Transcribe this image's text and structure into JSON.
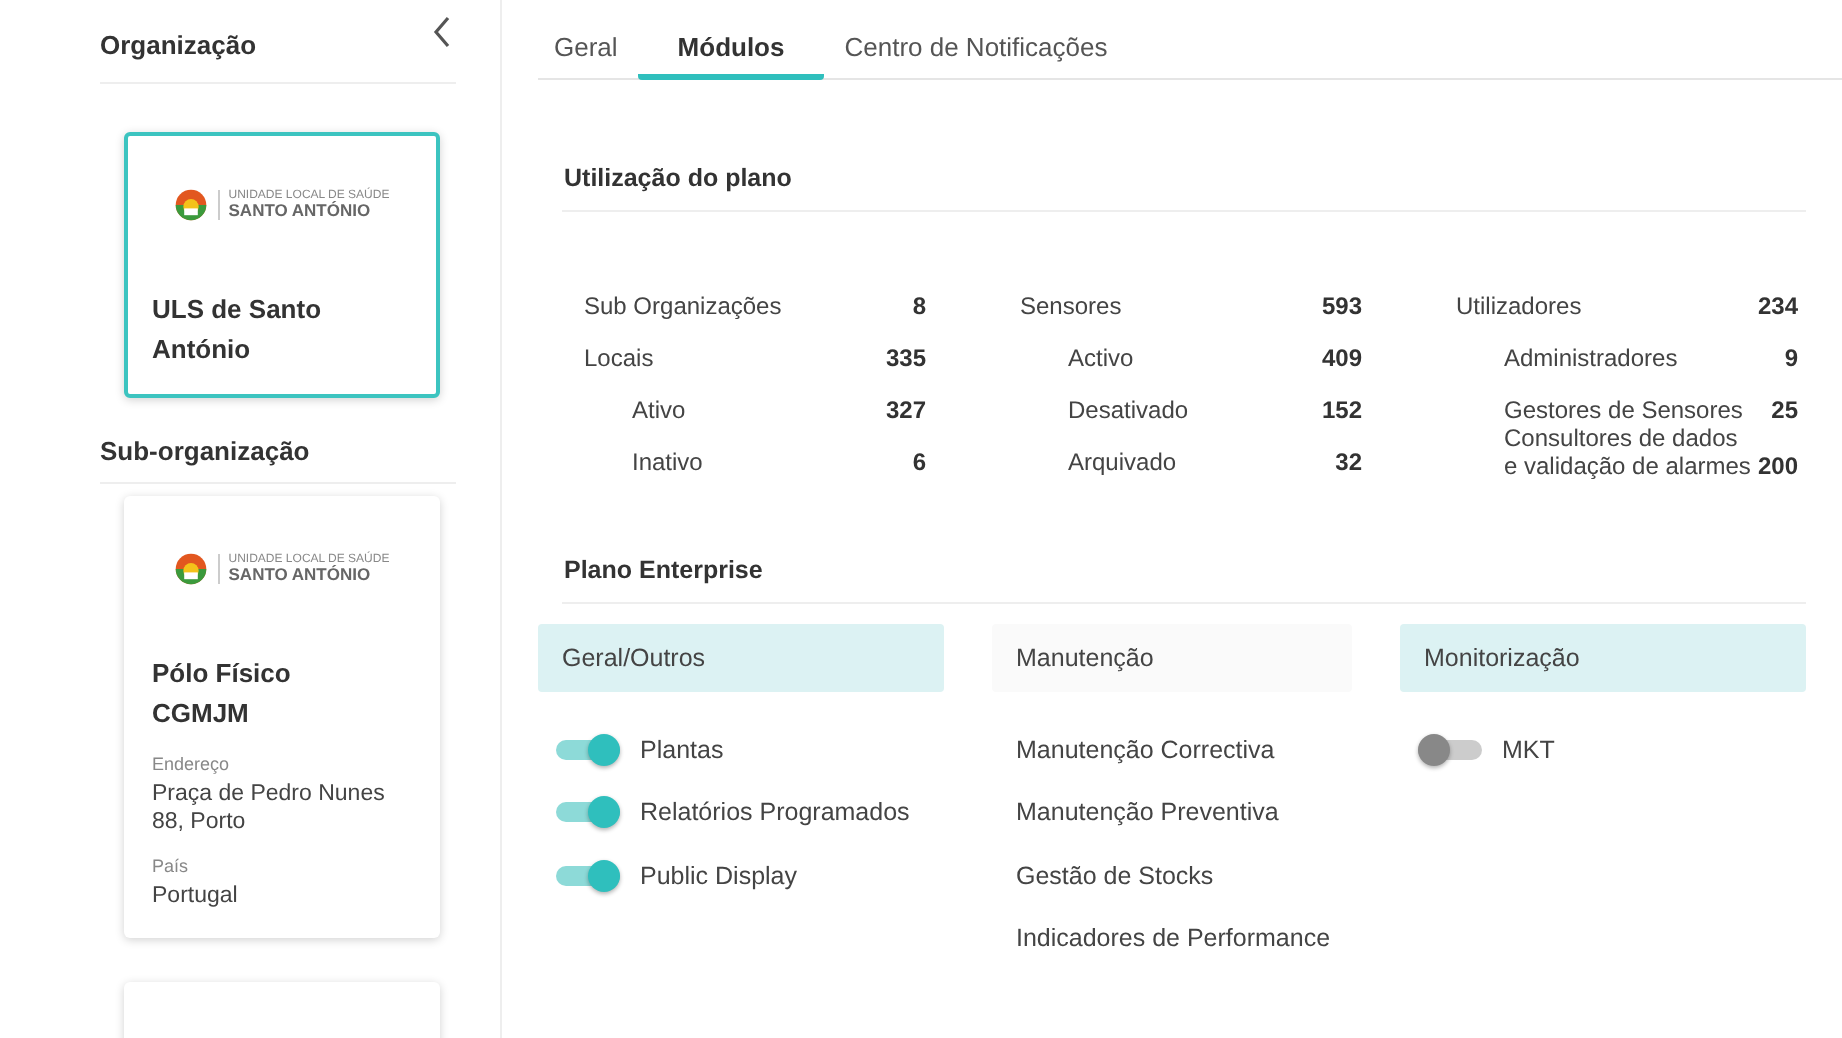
{
  "sidebar": {
    "title": "Organização",
    "organization": {
      "logo": [
        "UNIDADE LOCAL DE SAÚDE",
        "SANTO ANTÓNIO"
      ],
      "name": "ULS de Santo António",
      "selected": true
    },
    "sub_title": "Sub-organização",
    "sub_organizations": [
      {
        "logo": [
          "UNIDADE LOCAL DE SAÚDE",
          "SANTO ANTÓNIO"
        ],
        "name": "Pólo Físico CGMJM",
        "fields": [
          {
            "label": "Endereço",
            "value": "Praça de Pedro Nunes 88, Porto"
          },
          {
            "label": "País",
            "value": "Portugal"
          }
        ],
        "selected": false
      },
      {
        "selected": false
      }
    ]
  },
  "tabs": [
    {
      "label": "Geral",
      "selected": false
    },
    {
      "label": "Módulos",
      "selected": true
    },
    {
      "label": "Centro de Notificações",
      "selected": false
    }
  ],
  "usage": {
    "title": "Utilização do plano",
    "columns": [
      [
        {
          "label": "Sub Organizações",
          "value": "8"
        },
        {
          "label": "Locais",
          "value": "335",
          "children": [
            {
              "label": "Ativo",
              "value": "327"
            },
            {
              "label": "Inativo",
              "value": "6"
            }
          ]
        }
      ],
      [
        {
          "label": "Sensores",
          "value": "593",
          "children": [
            {
              "label": "Activo",
              "value": "409"
            },
            {
              "label": "Desativado",
              "value": "152"
            },
            {
              "label": "Arquivado",
              "value": "32"
            }
          ]
        }
      ],
      [
        {
          "label": "Utilizadores",
          "value": "234",
          "children": [
            {
              "label": "Administradores",
              "value": "9"
            },
            {
              "label": "Gestores de Sensores",
              "value": "25"
            },
            {
              "label": "Consultores de dados e validação de alarmes",
              "value": "200"
            }
          ]
        }
      ]
    ]
  },
  "plan": {
    "title": "Plano Enterprise",
    "groups": [
      {
        "title": "Geral/Outros",
        "active": true,
        "items": [
          {
            "kind": "toggle",
            "label": "Plantas",
            "on": true
          },
          {
            "kind": "toggle",
            "label": "Relatórios Programados",
            "on": true
          },
          {
            "kind": "toggle",
            "label": "Public Display",
            "on": true
          }
        ]
      },
      {
        "title": "Manutenção",
        "active": false,
        "items": [
          {
            "kind": "plain",
            "label": "Manutenção Correctiva"
          },
          {
            "kind": "plain",
            "label": "Manutenção Preventiva"
          },
          {
            "kind": "plain",
            "label": "Gestão de Stocks"
          },
          {
            "kind": "plain",
            "label": "Indicadores de Performance"
          }
        ]
      },
      {
        "title": "Monitorização",
        "active": true,
        "items": [
          {
            "kind": "toggle",
            "label": "MKT",
            "on": false
          }
        ]
      }
    ]
  }
}
